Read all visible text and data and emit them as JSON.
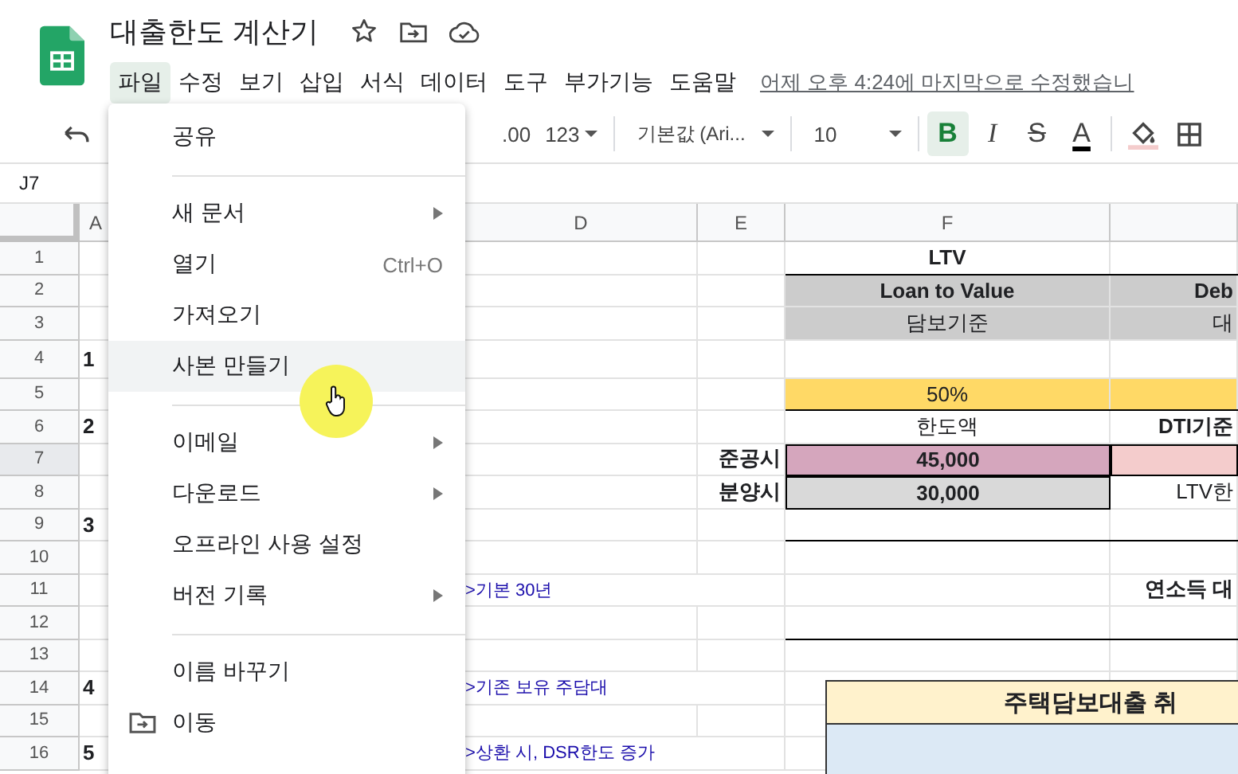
{
  "document": {
    "title": "대출한도 계산기"
  },
  "menubar": [
    {
      "label": "파일",
      "selected": true
    },
    {
      "label": "수정",
      "selected": false
    },
    {
      "label": "보기",
      "selected": false
    },
    {
      "label": "삽입",
      "selected": false
    },
    {
      "label": "서식",
      "selected": false
    },
    {
      "label": "데이터",
      "selected": false
    },
    {
      "label": "도구",
      "selected": false
    },
    {
      "label": "부가기능",
      "selected": false
    },
    {
      "label": "도움말",
      "selected": false
    }
  ],
  "last_edit": "어제 오후 4:24에 마지막으로 수정했습니",
  "toolbar": {
    "decimals": ".00",
    "number_format": "123",
    "font": "기본값 (Ari...",
    "font_size": "10",
    "styles": [
      {
        "label": "B",
        "kind": "bold",
        "active": true
      },
      {
        "label": "I",
        "kind": "italic",
        "active": false
      },
      {
        "label": "S",
        "kind": "strike",
        "active": false
      },
      {
        "label": "A",
        "kind": "color",
        "active": false
      }
    ]
  },
  "name_box": "J7",
  "file_menu": [
    {
      "kind": "item",
      "label": "공유",
      "highlighted": false,
      "submenu": false
    },
    {
      "kind": "divider"
    },
    {
      "kind": "item",
      "label": "새 문서",
      "highlighted": false,
      "submenu": true
    },
    {
      "kind": "item",
      "label": "열기",
      "shortcut": "Ctrl+O",
      "highlighted": false,
      "submenu": false
    },
    {
      "kind": "item",
      "label": "가져오기",
      "highlighted": false,
      "submenu": false
    },
    {
      "kind": "item",
      "label": "사본 만들기",
      "highlighted": true,
      "submenu": false
    },
    {
      "kind": "divider"
    },
    {
      "kind": "item",
      "label": "이메일",
      "highlighted": false,
      "submenu": true
    },
    {
      "kind": "item",
      "label": "다운로드",
      "highlighted": false,
      "submenu": true
    },
    {
      "kind": "item",
      "label": "오프라인 사용 설정",
      "highlighted": false,
      "submenu": false
    },
    {
      "kind": "item",
      "label": "버전 기록",
      "highlighted": false,
      "submenu": true
    },
    {
      "kind": "divider"
    },
    {
      "kind": "item",
      "label": "이름 바꾸기",
      "highlighted": false,
      "submenu": false
    },
    {
      "kind": "icon-item",
      "label": "이동",
      "highlighted": false,
      "submenu": false
    }
  ],
  "sheet": {
    "columns": [
      "A",
      "D",
      "E",
      "F"
    ],
    "rows": [
      {
        "number": "1",
        "selected": false,
        "rule_below": true,
        "F": {
          "text": "LTV",
          "bold": true
        }
      },
      {
        "number": "2",
        "selected": false,
        "rule_below": false,
        "F": {
          "text": "Loan to Value",
          "bold": true,
          "color": "#cccccc"
        },
        "G": {
          "text": "Deb",
          "bold": true,
          "color": "#cccccc"
        }
      },
      {
        "number": "3",
        "selected": false,
        "rule_below": false,
        "F": {
          "text": "담보기준",
          "bold": false,
          "color": "#cccccc"
        },
        "G": {
          "text": "대",
          "bold": false,
          "color": "#cccccc"
        }
      },
      {
        "number": "4",
        "selected": false,
        "rule_below": false,
        "A": {
          "text": "1",
          "bold": true
        }
      },
      {
        "number": "5",
        "selected": false,
        "rule_below": true,
        "F": {
          "text": "50%",
          "bold": false,
          "color": "#ffd966"
        },
        "G": {
          "color": "#ffd966"
        }
      },
      {
        "number": "6",
        "selected": false,
        "rule_below": false,
        "A": {
          "text": "2",
          "bold": true
        },
        "F": {
          "text": "한도액",
          "bold": false
        },
        "G": {
          "text": "DTI기준",
          "bold": true
        }
      },
      {
        "number": "7",
        "selected": true,
        "rule_below": false,
        "E": {
          "text": "준공시",
          "bold": true
        },
        "F": {
          "text": "45,000",
          "bold": true,
          "color": "#d5a6bd",
          "boxed": true
        },
        "G": {
          "color": "#f4cccc",
          "boxed": true
        }
      },
      {
        "number": "8",
        "selected": false,
        "rule_below": false,
        "E": {
          "text": "분양시",
          "bold": true
        },
        "F": {
          "text": "30,000",
          "bold": true,
          "color": "#d9d9d9",
          "boxed": true
        },
        "G": {
          "text": "LTV한",
          "bold": false
        }
      },
      {
        "number": "9",
        "selected": false,
        "rule_below": true,
        "A": {
          "text": "3",
          "bold": true
        }
      },
      {
        "number": "10",
        "selected": false,
        "rule_below": false
      },
      {
        "number": "11",
        "selected": false,
        "rule_below": false,
        "D": {
          "text": ">기본 30년",
          "kind": "note"
        },
        "G": {
          "text": "연소득 대",
          "bold": true
        }
      },
      {
        "number": "12",
        "selected": false,
        "rule_below": true
      },
      {
        "number": "13",
        "selected": false,
        "rule_below": false
      },
      {
        "number": "14",
        "selected": false,
        "rule_below": false,
        "A": {
          "text": "4",
          "bold": true
        },
        "D": {
          "text": ">기존 보유 주담대",
          "kind": "note"
        }
      },
      {
        "number": "15",
        "selected": false,
        "rule_below": false
      },
      {
        "number": "16",
        "selected": false,
        "rule_below": false,
        "A": {
          "text": "5",
          "bold": true
        },
        "D": {
          "text": ">상환 시, DSR한도 증가",
          "kind": "note"
        }
      }
    ]
  },
  "embedded_table": {
    "title": "주택담보대출 취"
  }
}
